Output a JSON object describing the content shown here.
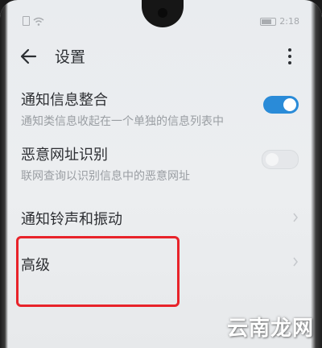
{
  "statusbar": {
    "time": "2:18"
  },
  "header": {
    "title": "设置"
  },
  "items": [
    {
      "title": "通知信息整合",
      "subtitle": "通知类信息收起在一个单独的信息列表中",
      "toggle": "on"
    },
    {
      "title": "恶意网址识别",
      "subtitle": "联网查询以识别信息中的恶意网址",
      "toggle": "off"
    },
    {
      "title": "通知铃声和振动"
    },
    {
      "title": "高级"
    }
  ],
  "watermark": "云南龙网",
  "colors": {
    "accent": "#2a8bd8",
    "highlight": "#e8232a"
  }
}
